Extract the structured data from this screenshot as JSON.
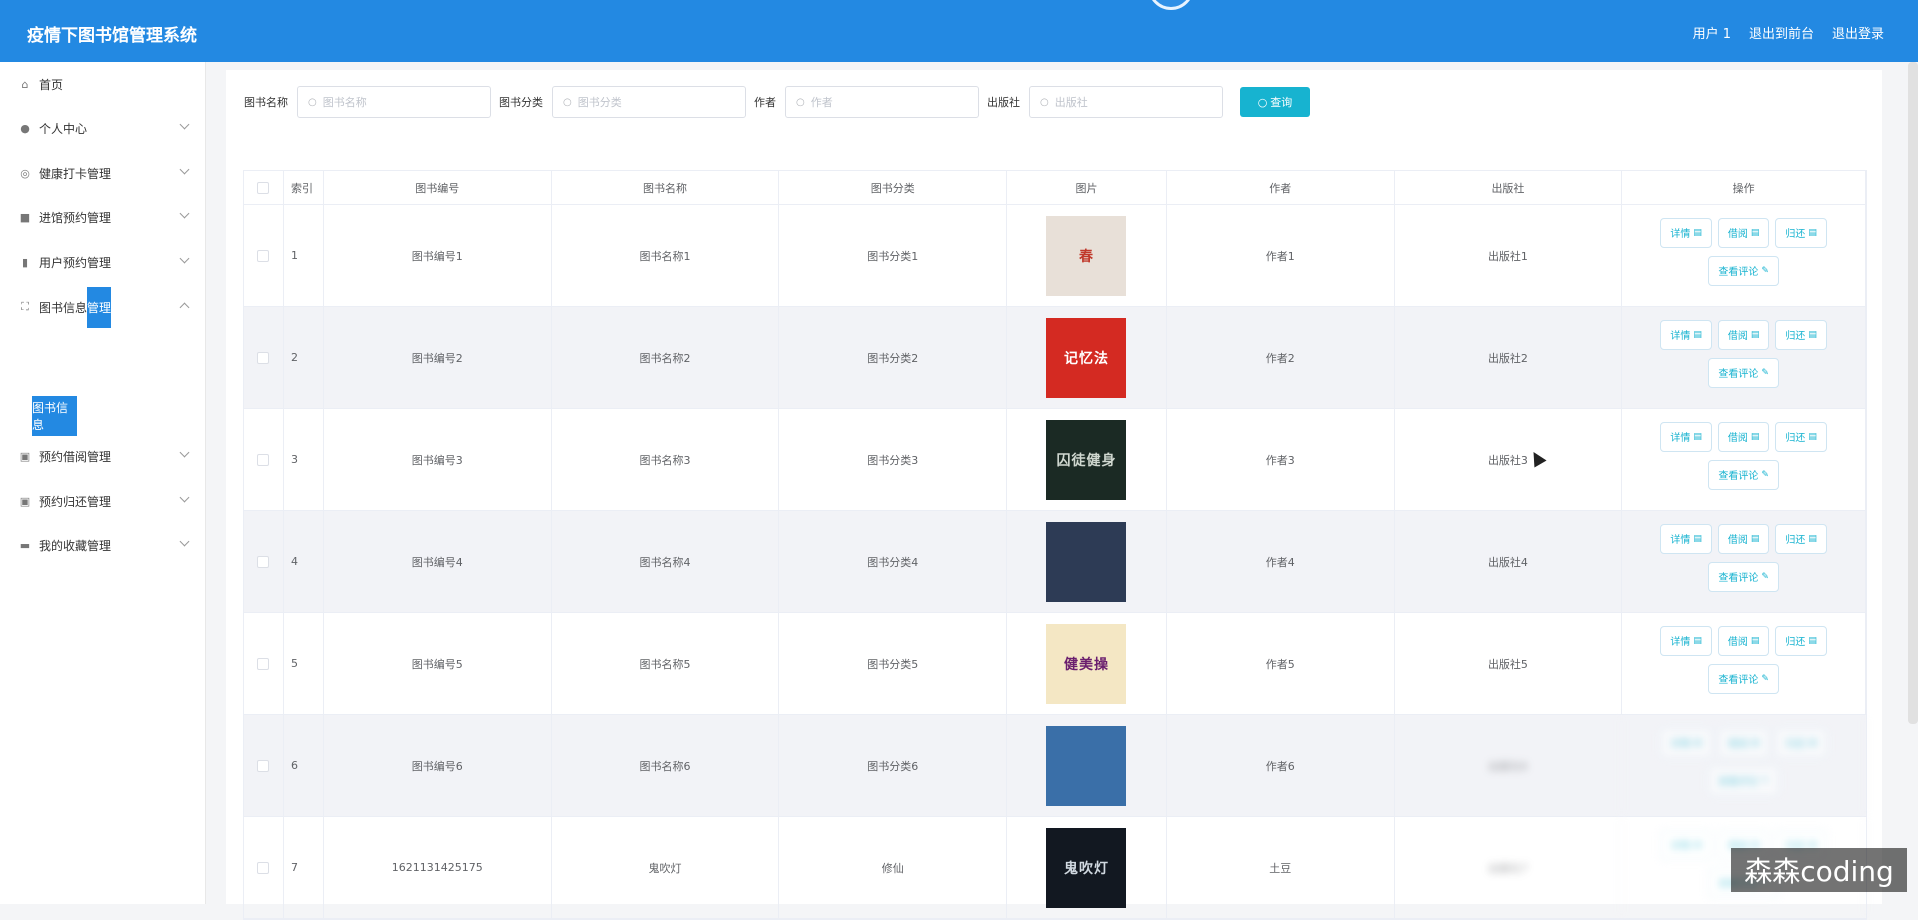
{
  "header": {
    "title": "疫情下图书馆管理系统",
    "links": [
      "用户 1",
      "退出到前台",
      "退出登录"
    ]
  },
  "sidebar": {
    "items": [
      {
        "label": "首页",
        "icon": "home-icon"
      },
      {
        "label": "个人中心",
        "icon": "user-icon"
      },
      {
        "label": "健康打卡管理",
        "icon": "compass-icon"
      },
      {
        "label": "进馆预约管理",
        "icon": "briefcase-icon"
      },
      {
        "label": "用户预约管理",
        "icon": "bar-chart-icon"
      },
      {
        "label": "图书信息",
        "label_highlight": "管理",
        "icon": "scan-icon"
      },
      {
        "label": "预约借阅管理",
        "icon": "clipboard-icon"
      },
      {
        "label": "预约归还管理",
        "icon": "clipboard-icon"
      },
      {
        "label": "我的收藏管理",
        "icon": "monitor-icon"
      }
    ],
    "sub_item": "图书信息"
  },
  "search": {
    "fields": [
      {
        "label": "图书名称",
        "placeholder": "图书名称"
      },
      {
        "label": "图书分类",
        "placeholder": "图书分类"
      },
      {
        "label": "作者",
        "placeholder": "作者"
      },
      {
        "label": "出版社",
        "placeholder": "出版社"
      }
    ],
    "button": "查询"
  },
  "table": {
    "columns": [
      "索引",
      "图书编号",
      "图书名称",
      "图书分类",
      "图片",
      "作者",
      "出版社",
      "操作"
    ],
    "rows": [
      {
        "idx": "1",
        "no": "图书编号1",
        "name": "图书名称1",
        "cat": "图书分类1",
        "author": "作者1",
        "pub": "出版社1",
        "cover_color": "#e8e0d8",
        "cover_accent": "#c0392b",
        "cover_text": "春"
      },
      {
        "idx": "2",
        "no": "图书编号2",
        "name": "图书名称2",
        "cat": "图书分类2",
        "author": "作者2",
        "pub": "出版社2",
        "cover_color": "#d42a22",
        "cover_accent": "#ffffff",
        "cover_text": "记忆法"
      },
      {
        "idx": "3",
        "no": "图书编号3",
        "name": "图书名称3",
        "cat": "图书分类3",
        "author": "作者3",
        "pub": "出版社3",
        "cover_color": "#1b2a24",
        "cover_accent": "#cfd7cf",
        "cover_text": "囚徒健身"
      },
      {
        "idx": "4",
        "no": "图书编号4",
        "name": "图书名称4",
        "cat": "图书分类4",
        "author": "作者4",
        "pub": "出版社4",
        "cover_color": "#2d3b55",
        "cover_accent": "#a8b8d8",
        "cover_text": ""
      },
      {
        "idx": "5",
        "no": "图书编号5",
        "name": "图书名称5",
        "cat": "图书分类5",
        "author": "作者5",
        "pub": "出版社5",
        "cover_color": "#f4e7c4",
        "cover_accent": "#6a1e6e",
        "cover_text": "健美操"
      },
      {
        "idx": "6",
        "no": "图书编号6",
        "name": "图书名称6",
        "cat": "图书分类6",
        "author": "作者6",
        "pub": "出版社6",
        "cover_color": "#3a6fa8",
        "cover_accent": "#e0a030",
        "cover_text": ""
      },
      {
        "idx": "7",
        "no": "1621131425175",
        "name": "鬼吹灯",
        "cat": "修仙",
        "author": "土豆",
        "pub": "出版社7",
        "cover_color": "#121821",
        "cover_accent": "#d0d8e0",
        "cover_text": "鬼吹灯"
      }
    ],
    "ops": [
      "详情",
      "借阅",
      "归还",
      "查看评论"
    ]
  },
  "watermark": "森森coding"
}
